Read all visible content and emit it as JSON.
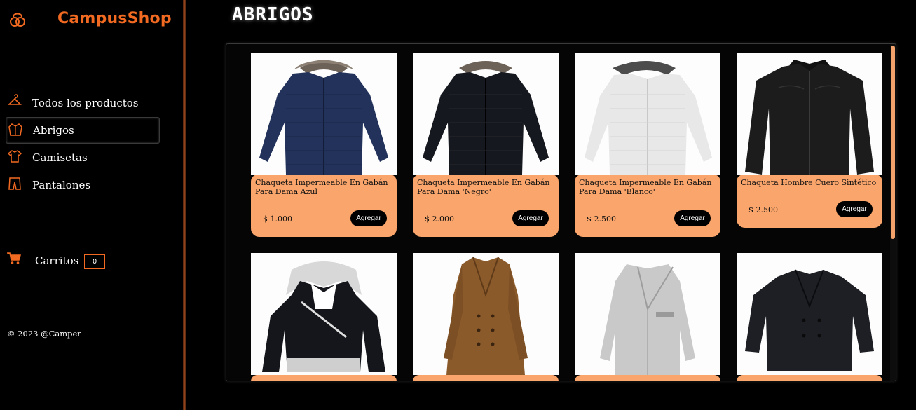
{
  "brand": {
    "name": "CampusShop",
    "icon": "campus-logo-icon",
    "color": "#f26a21"
  },
  "nav": [
    {
      "label": "Todos los productos",
      "icon": "hanger-icon"
    },
    {
      "label": "Abrigos",
      "icon": "coat-icon",
      "active": true
    },
    {
      "label": "Camisetas",
      "icon": "tshirt-icon"
    },
    {
      "label": "Pantalones",
      "icon": "pants-icon"
    }
  ],
  "cart": {
    "label": "Carritos",
    "count": "0",
    "icon": "cart-icon"
  },
  "footer": {
    "text": "© 2023 @Camper"
  },
  "page": {
    "title": "ABRIGOS"
  },
  "products": [
    {
      "name": "Chaqueta Impermeable En Gabán Para Dama Azul",
      "price": "$ 1.000",
      "button": "Agregar",
      "image": "navy-hooded-parka"
    },
    {
      "name": "Chaqueta Impermeable En Gabán Para Dama 'Negro'",
      "price": "$ 2.000",
      "button": "Agregar",
      "image": "black-hooded-parka"
    },
    {
      "name": "Chaqueta Impermeable En Gabán Para Dama 'Blanco'",
      "price": "$ 2.500",
      "button": "Agregar",
      "image": "white-hooded-parka"
    },
    {
      "name": "Chaqueta Hombre Cuero Sintético",
      "price": "$ 2.500",
      "button": "Agregar",
      "image": "black-leather-jacket"
    },
    {
      "name": "",
      "price": "",
      "button": "",
      "image": "hooded-zip-jacket"
    },
    {
      "name": "",
      "price": "",
      "button": "",
      "image": "brown-trench-coat"
    },
    {
      "name": "",
      "price": "",
      "button": "",
      "image": "grey-wool-coat"
    },
    {
      "name": "",
      "price": "",
      "button": "",
      "image": "black-peacoat"
    }
  ],
  "colors": {
    "accent": "#f26a21",
    "card": "#f9a56b",
    "scroll_thumb": "#f2a26a"
  }
}
